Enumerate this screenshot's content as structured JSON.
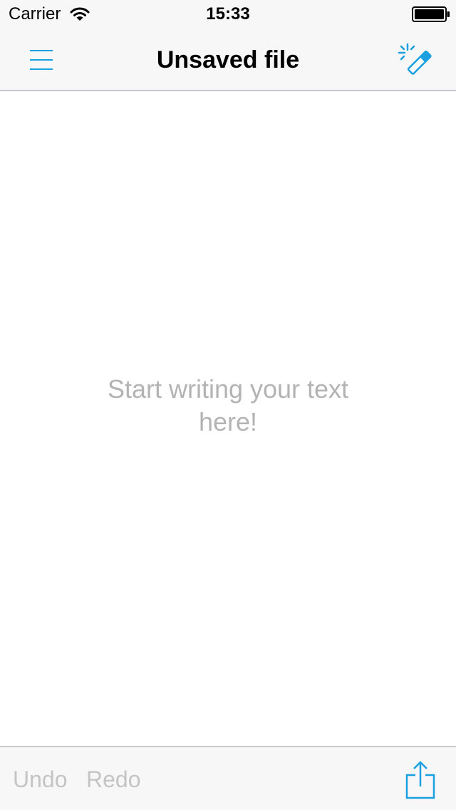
{
  "status_bar": {
    "carrier": "Carrier",
    "time": "15:33",
    "icons": [
      "wifi-icon",
      "battery-icon"
    ]
  },
  "nav_bar": {
    "title": "Unsaved file",
    "left_icon": "menu-icon",
    "right_icon": "magic-wand-icon"
  },
  "editor": {
    "placeholder": "Start writing your text here!"
  },
  "toolbar": {
    "undo_label": "Undo",
    "redo_label": "Redo",
    "share_icon": "share-icon"
  },
  "colors": {
    "accent": "#1a9fe0",
    "bar_background": "#f7f7f7",
    "separator": "#c8c8cc",
    "placeholder_text": "#b3b3b3",
    "disabled_text": "#c4c4c4"
  }
}
